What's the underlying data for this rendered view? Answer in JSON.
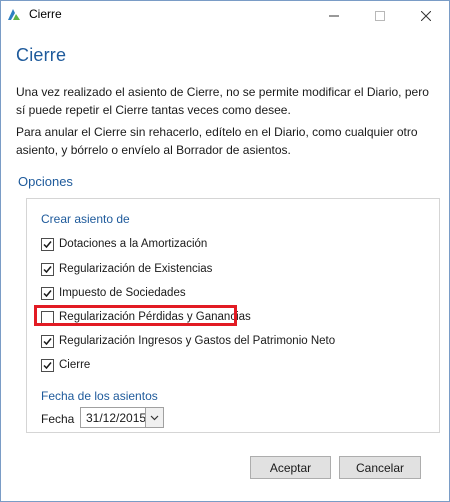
{
  "window": {
    "title": "Cierre",
    "controls": {
      "minimize": "minimize-icon",
      "maximize": "maximize-icon",
      "close": "close-icon"
    }
  },
  "content": {
    "heading": "Cierre",
    "paragraph1": "Una vez realizado el asiento de Cierre, no se permite modificar el Diario, pero sí puede repetir el Cierre tantas veces como desee.",
    "paragraph2": "Para anular el Cierre sin rehacerlo, edítelo en el Diario, como cualquier otro asiento, y bórrelo o envíelo al Borrador de asientos.",
    "options_label": "Opciones"
  },
  "options": {
    "group_title": "Crear asiento de",
    "checkboxes": [
      {
        "label": "Dotaciones a la Amortización",
        "checked": true
      },
      {
        "label": "Regularización de Existencias",
        "checked": true
      },
      {
        "label": "Impuesto de Sociedades",
        "checked": true
      },
      {
        "label": "Regularización Pérdidas y Ganancias",
        "checked": false
      },
      {
        "label": "Regularización Ingresos y Gastos del Patrimonio Neto",
        "checked": true
      },
      {
        "label": "Cierre",
        "checked": true
      }
    ],
    "date_group_title": "Fecha de los asientos",
    "date_label": "Fecha",
    "date_value": "31/12/2015"
  },
  "buttons": {
    "accept": "Aceptar",
    "cancel": "Cancelar"
  },
  "colors": {
    "accent": "#1e5a9b",
    "highlight": "#e21b23"
  }
}
